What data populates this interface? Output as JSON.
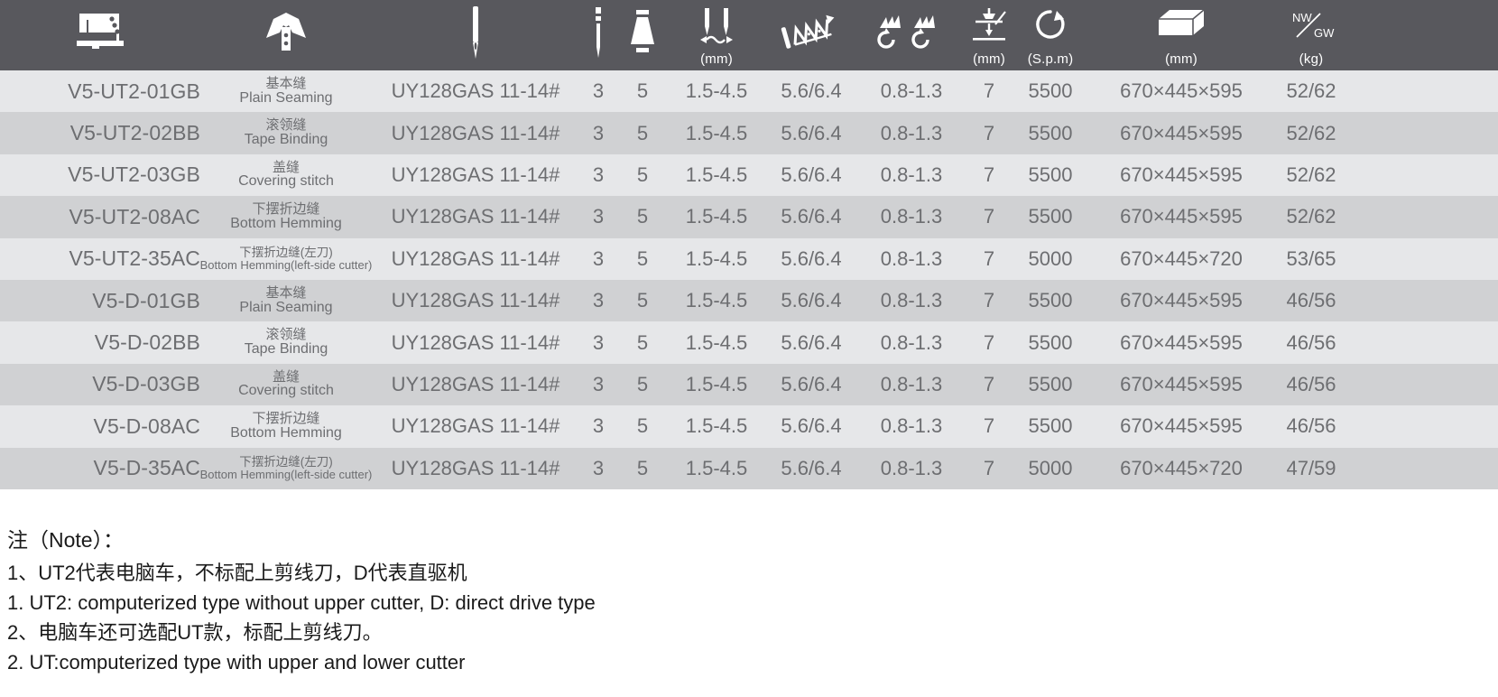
{
  "header": {
    "columns": [
      {
        "id": "model",
        "icon": "sewing-machine-icon",
        "unit": ""
      },
      {
        "id": "stitch",
        "icon": "shirt-collar-icon",
        "unit": ""
      },
      {
        "id": "needle",
        "icon": "needle-icon",
        "unit": ""
      },
      {
        "id": "nn",
        "icon": "needle-count-icon",
        "unit": ""
      },
      {
        "id": "th",
        "icon": "thread-cone-icon",
        "unit": ""
      },
      {
        "id": "gauge",
        "icon": "needle-gauge-icon",
        "unit": "(mm)"
      },
      {
        "id": "stlen",
        "icon": "stitch-length-icon",
        "unit": ""
      },
      {
        "id": "liftf",
        "icon": "differential-feed-icon",
        "unit": ""
      },
      {
        "id": "lift",
        "icon": "presser-foot-lift-icon",
        "unit": "(mm)"
      },
      {
        "id": "speed",
        "icon": "rotation-speed-icon",
        "unit": "(S.p.m)"
      },
      {
        "id": "dim",
        "icon": "carton-box-icon",
        "unit": "(mm)"
      },
      {
        "id": "wt",
        "icon": "net-gross-weight-icon",
        "unit": "(kg)"
      }
    ],
    "weight_icon_text": {
      "nw": "NW",
      "gw": "GW"
    }
  },
  "table": {
    "rows": [
      {
        "model": "V5-UT2-01GB",
        "stitch_zh": "基本缝",
        "stitch_en": "Plain Seaming",
        "small": false,
        "needle": "UY128GAS 11-14#",
        "needle_count": "3",
        "thread_count": "5",
        "gauge": "1.5-4.5",
        "stitch_length": "5.6/6.4",
        "feed": "0.8-1.3",
        "lift": "7",
        "speed": "5500",
        "dimensions": "670×445×595",
        "weight": "52/62"
      },
      {
        "model": "V5-UT2-02BB",
        "stitch_zh": "滚领缝",
        "stitch_en": "Tape Binding",
        "small": false,
        "needle": "UY128GAS 11-14#",
        "needle_count": "3",
        "thread_count": "5",
        "gauge": "1.5-4.5",
        "stitch_length": "5.6/6.4",
        "feed": "0.8-1.3",
        "lift": "7",
        "speed": "5500",
        "dimensions": "670×445×595",
        "weight": "52/62"
      },
      {
        "model": "V5-UT2-03GB",
        "stitch_zh": "盖缝",
        "stitch_en": "Covering stitch",
        "small": false,
        "needle": "UY128GAS 11-14#",
        "needle_count": "3",
        "thread_count": "5",
        "gauge": "1.5-4.5",
        "stitch_length": "5.6/6.4",
        "feed": "0.8-1.3",
        "lift": "7",
        "speed": "5500",
        "dimensions": "670×445×595",
        "weight": "52/62"
      },
      {
        "model": "V5-UT2-08AC",
        "stitch_zh": "下摆折边缝",
        "stitch_en": "Bottom Hemming",
        "small": false,
        "needle": "UY128GAS 11-14#",
        "needle_count": "3",
        "thread_count": "5",
        "gauge": "1.5-4.5",
        "stitch_length": "5.6/6.4",
        "feed": "0.8-1.3",
        "lift": "7",
        "speed": "5500",
        "dimensions": "670×445×595",
        "weight": "52/62"
      },
      {
        "model": "V5-UT2-35AC",
        "stitch_zh": "下摆折边缝(左刀)",
        "stitch_en": "Bottom Hemming(left-side cutter)",
        "small": true,
        "needle": "UY128GAS 11-14#",
        "needle_count": "3",
        "thread_count": "5",
        "gauge": "1.5-4.5",
        "stitch_length": "5.6/6.4",
        "feed": "0.8-1.3",
        "lift": "7",
        "speed": "5000",
        "dimensions": "670×445×720",
        "weight": "53/65"
      },
      {
        "model": "V5-D-01GB",
        "stitch_zh": "基本缝",
        "stitch_en": "Plain Seaming",
        "small": false,
        "needle": "UY128GAS 11-14#",
        "needle_count": "3",
        "thread_count": "5",
        "gauge": "1.5-4.5",
        "stitch_length": "5.6/6.4",
        "feed": "0.8-1.3",
        "lift": "7",
        "speed": "5500",
        "dimensions": "670×445×595",
        "weight": "46/56"
      },
      {
        "model": "V5-D-02BB",
        "stitch_zh": "滚领缝",
        "stitch_en": "Tape Binding",
        "small": false,
        "needle": "UY128GAS 11-14#",
        "needle_count": "3",
        "thread_count": "5",
        "gauge": "1.5-4.5",
        "stitch_length": "5.6/6.4",
        "feed": "0.8-1.3",
        "lift": "7",
        "speed": "5500",
        "dimensions": "670×445×595",
        "weight": "46/56"
      },
      {
        "model": "V5-D-03GB",
        "stitch_zh": "盖缝",
        "stitch_en": "Covering stitch",
        "small": false,
        "needle": "UY128GAS 11-14#",
        "needle_count": "3",
        "thread_count": "5",
        "gauge": "1.5-4.5",
        "stitch_length": "5.6/6.4",
        "feed": "0.8-1.3",
        "lift": "7",
        "speed": "5500",
        "dimensions": "670×445×595",
        "weight": "46/56"
      },
      {
        "model": "V5-D-08AC",
        "stitch_zh": "下摆折边缝",
        "stitch_en": "Bottom Hemming",
        "small": false,
        "needle": "UY128GAS 11-14#",
        "needle_count": "3",
        "thread_count": "5",
        "gauge": "1.5-4.5",
        "stitch_length": "5.6/6.4",
        "feed": "0.8-1.3",
        "lift": "7",
        "speed": "5500",
        "dimensions": "670×445×595",
        "weight": "46/56"
      },
      {
        "model": "V5-D-35AC",
        "stitch_zh": "下摆折边缝(左刀)",
        "stitch_en": "Bottom Hemming(left-side cutter)",
        "small": true,
        "needle": "UY128GAS 11-14#",
        "needle_count": "3",
        "thread_count": "5",
        "gauge": "1.5-4.5",
        "stitch_length": "5.6/6.4",
        "feed": "0.8-1.3",
        "lift": "7",
        "speed": "5000",
        "dimensions": "670×445×720",
        "weight": "47/59"
      }
    ]
  },
  "notes": {
    "title": "注（Note）：",
    "lines": [
      "1、UT2代表电脑车，不标配上剪线刀，D代表直驱机",
      "1. UT2: computerized type without upper cutter,   D: direct drive type",
      "2、电脑车还可选配UT款，标配上剪线刀。",
      "2. UT:computerized type with upper and lower cutter"
    ]
  },
  "colors": {
    "header_bg": "#58585d",
    "row_odd": "#e6e7e9",
    "row_even": "#d0d1d3",
    "text": "#6d6e71",
    "note_text": "#1a1a1a"
  }
}
